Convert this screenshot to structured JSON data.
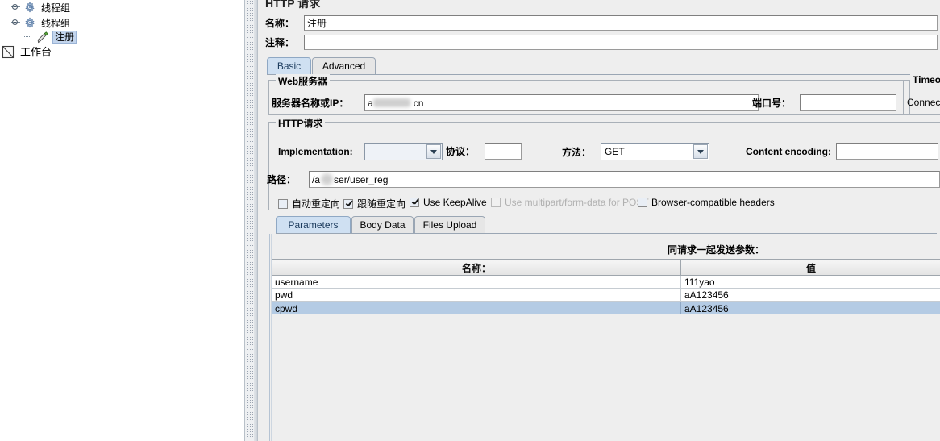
{
  "window": {
    "title": "HTTP 请求"
  },
  "tree": {
    "items": [
      {
        "label": "线程组",
        "icon": "thread-group-icon",
        "selected": false
      },
      {
        "label": "线程组",
        "icon": "thread-group-icon",
        "selected": false
      },
      {
        "label": "注册",
        "icon": "http-request-icon",
        "selected": true
      },
      {
        "label": "工作台",
        "icon": "workbench-icon",
        "selected": false
      }
    ]
  },
  "form": {
    "name_label": "名称：",
    "name_value": "注册",
    "comment_label": "注释：",
    "comment_value": ""
  },
  "main_tabs": [
    {
      "label": "Basic",
      "active": true
    },
    {
      "label": "Advanced",
      "active": false
    }
  ],
  "web_server": {
    "group_label": "Web服务器",
    "server_label": "服务器名称或IP：",
    "server_value_prefix": "a",
    "server_value_suffix": "cn",
    "port_label": "端口号：",
    "port_value": ""
  },
  "timeouts": {
    "group_label": "Timeouts",
    "connect_label": "Connec"
  },
  "http_request": {
    "group_label": "HTTP请求",
    "implementation_label": "Implementation:",
    "implementation_value": "",
    "protocol_label": "协议：",
    "protocol_value": "",
    "method_label": "方法：",
    "method_value": "GET",
    "content_encoding_label": "Content encoding:",
    "content_encoding_value": "",
    "path_label": "路径：",
    "path_value_prefix": "/a",
    "path_value_suffix": "ser/user_reg"
  },
  "options": [
    {
      "label": "自动重定向",
      "checked": false,
      "disabled": false
    },
    {
      "label": "跟随重定向",
      "checked": true,
      "disabled": false
    },
    {
      "label": "Use KeepAlive",
      "checked": true,
      "disabled": false
    },
    {
      "label": "Use multipart/form-data for POST",
      "checked": false,
      "disabled": true
    },
    {
      "label": "Browser-compatible headers",
      "checked": false,
      "disabled": false
    }
  ],
  "param_tabs": [
    {
      "label": "Parameters",
      "active": true
    },
    {
      "label": "Body Data",
      "active": false
    },
    {
      "label": "Files Upload",
      "active": false
    }
  ],
  "params_table": {
    "send_with_request_label": "同请求一起发送参数：",
    "columns": [
      "名称：",
      "值"
    ],
    "rows": [
      {
        "name": "username",
        "value": "111yao",
        "selected": false
      },
      {
        "name": "pwd",
        "value": "aA123456",
        "selected": false
      },
      {
        "name": "cpwd",
        "value": "aA123456",
        "selected": true
      }
    ]
  },
  "colors": {
    "panel_bg": "#eeeeee",
    "selection_blue": "#b4cbe4",
    "tab_active": "#cfe0f2",
    "field_bg": "#ffffff"
  }
}
